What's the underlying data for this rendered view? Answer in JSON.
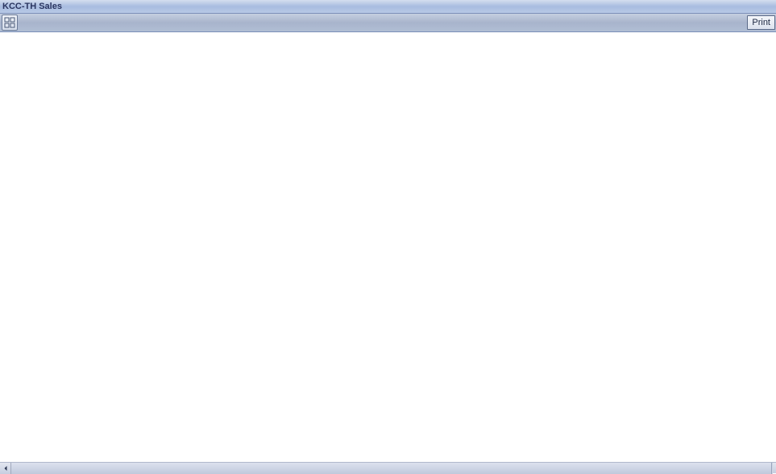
{
  "window": {
    "title": "KCC-TH Sales"
  },
  "toolbar": {
    "grid_icon": "grid-view",
    "print_label": "Print"
  }
}
